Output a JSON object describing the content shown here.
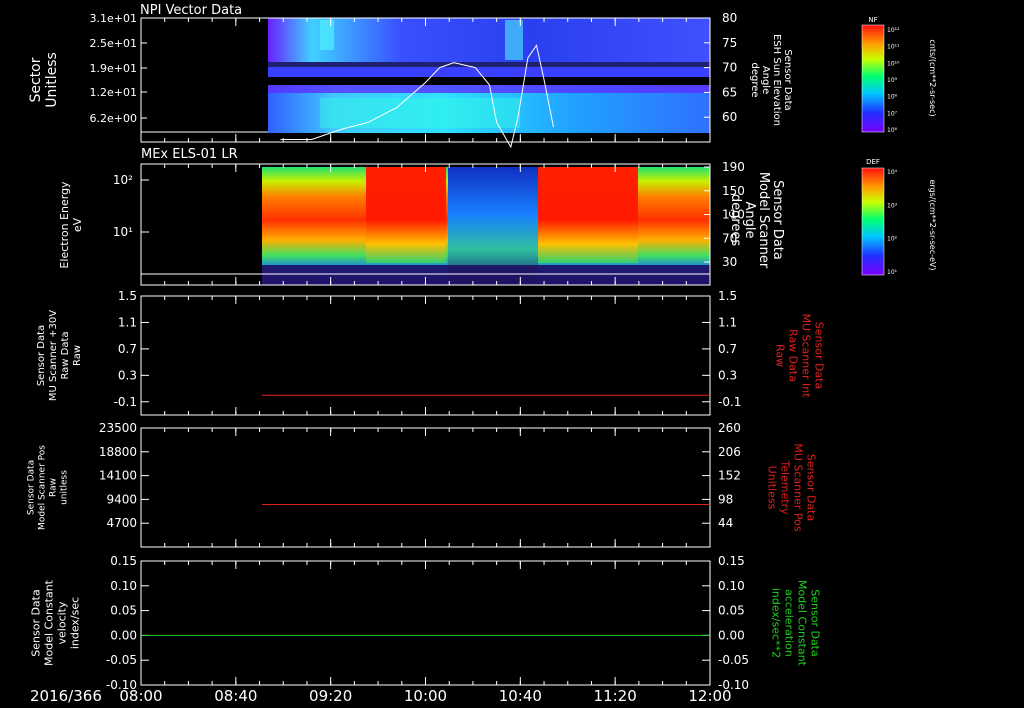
{
  "time_axis": {
    "date_label": "2016/366",
    "ticks": [
      "08:00",
      "08:40",
      "09:20",
      "10:00",
      "10:40",
      "11:20",
      "12:00"
    ],
    "tick_hours": [
      8.0,
      8.6667,
      9.3333,
      10.0,
      10.6667,
      11.3333,
      12.0
    ],
    "range_hours": [
      8.0,
      12.0
    ]
  },
  "colors": {
    "background": "#000000",
    "frame": "#ffffff",
    "red_trace": "#e0201c",
    "green_trace": "#1ed21e"
  },
  "chart_data": [
    {
      "type": "heatmap",
      "title": "NPI Vector Data",
      "ylabel": "Sector\nUnitless",
      "yticks": [
        "3.1e+01",
        "2.5e+01",
        "1.9e+01",
        "1.2e+01",
        "6.2e+00"
      ],
      "y2label": "Sensor Data\nESH Sun Elevation\nAngle\ndegree",
      "y2ticks": [
        "80",
        "75",
        "70",
        "65",
        "60"
      ],
      "y2lim": [
        55,
        80
      ],
      "data_start_hours": 8.98,
      "overlay_line": {
        "name": "",
        "color": "#ffffff",
        "x": [
          8.98,
          9.2,
          9.4,
          9.6,
          9.8,
          10.0,
          10.1,
          10.2,
          10.35,
          10.45,
          10.5,
          10.6,
          10.65,
          10.72,
          10.78,
          10.83,
          10.9
        ],
        "y": [
          55.5,
          55.5,
          57.5,
          59.0,
          62.0,
          67.0,
          70.0,
          71.0,
          70.0,
          66.5,
          59.0,
          54.0,
          60.0,
          72.0,
          74.5,
          68.0,
          58.0
        ]
      },
      "colorbar": {
        "label": "NF",
        "unit": "cnts/(cm**2-sr-sec)",
        "ticks": [
          "10¹²",
          "10¹¹",
          "10¹⁰",
          "10⁹",
          "10⁸",
          "10⁷",
          "10⁶"
        ]
      }
    },
    {
      "type": "heatmap",
      "title": "MEx ELS-01 LR",
      "ylabel": "Electron Energy\neV",
      "yticks": [
        "10²",
        "10¹"
      ],
      "y2label": "Sensor Data\nModel Scanner\nAngle\ndegrees",
      "y2ticks": [
        "190",
        "150",
        "110",
        "70",
        "30"
      ],
      "data_start_hours": 8.93,
      "colorbar": {
        "label": "DEF",
        "unit": "ergs/(cm**2-sr-sec-eV)",
        "ticks": [
          "10⁴",
          "10³",
          "10²",
          "10¹"
        ]
      }
    },
    {
      "type": "line",
      "ylabel": "Sensor Data\nMU Scanner +30V\nRaw Data\nRaw",
      "ylim": [
        -0.3,
        1.5
      ],
      "yticks": [
        "1.5",
        "1.1",
        "0.7",
        "0.3",
        "-0.1"
      ],
      "ytick_values": [
        1.5,
        1.1,
        0.7,
        0.3,
        -0.1
      ],
      "y2ticks": [
        "1.5",
        "1.1",
        "0.7",
        "0.3",
        "-0.1"
      ],
      "y2label": "Sensor Data\nMU Scanner Int\nRaw Data\nRaw",
      "series": [
        {
          "x": [
            8.85,
            12.0
          ],
          "y": [
            0.0,
            0.0
          ],
          "color": "#e0201c"
        }
      ]
    },
    {
      "type": "line",
      "ylabel": "Sensor Data\nModel Scanner Pos\nRaw\nunitless",
      "ylim": [
        0,
        23500
      ],
      "yticks": [
        "23500",
        "18800",
        "14100",
        "9400",
        "4700"
      ],
      "ytick_values": [
        23500,
        18800,
        14100,
        9400,
        4700
      ],
      "y2ticks": [
        "260",
        "206",
        "152",
        "98",
        "44"
      ],
      "y2label": "Sensor Data\nMU Scanner Pos\nTelemetry\nUnitless",
      "series": [
        {
          "x": [
            8.85,
            12.0
          ],
          "y": [
            8400,
            8400
          ],
          "color": "#e0201c"
        }
      ]
    },
    {
      "type": "line",
      "ylabel": "Sensor Data\nModel Constant\nvelocity\nindex/sec",
      "ylim": [
        -0.1,
        0.15
      ],
      "yticks": [
        "0.15",
        "0.10",
        "0.05",
        "0.00",
        "-0.05",
        "-0.10"
      ],
      "ytick_values": [
        0.15,
        0.1,
        0.05,
        0.0,
        -0.05,
        -0.1
      ],
      "y2ticks": [
        "0.15",
        "0.10",
        "0.05",
        "0.00",
        "-0.05",
        "-0.10"
      ],
      "y2label": "Sensor Data\nModel Constant\nacceleration\nindex/sec**2",
      "series": [
        {
          "x": [
            8.0,
            12.0
          ],
          "y": [
            0.0,
            0.0
          ],
          "color": "#1ed21e"
        }
      ]
    }
  ]
}
